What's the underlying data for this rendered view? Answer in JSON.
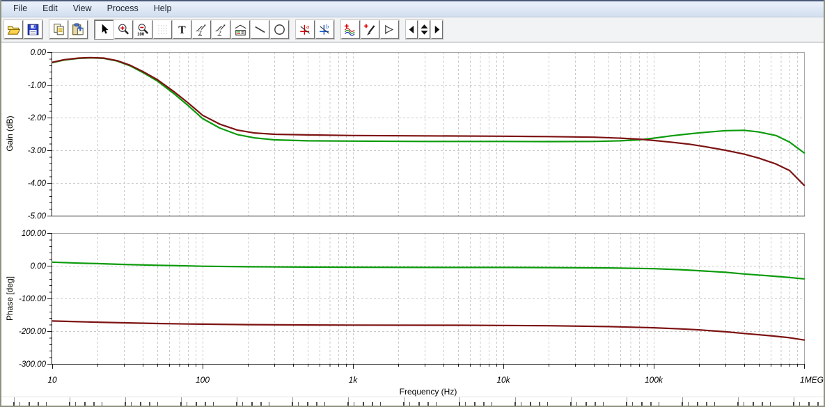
{
  "menu_bar": {
    "items": [
      {
        "label": "File"
      },
      {
        "label": "Edit"
      },
      {
        "label": "View"
      },
      {
        "label": "Process"
      },
      {
        "label": "Help"
      }
    ]
  },
  "toolbar": {
    "buttons": [
      {
        "icon": "open-folder-icon",
        "name": "open-button"
      },
      {
        "icon": "save-icon",
        "name": "save-button"
      },
      {
        "sep": true
      },
      {
        "icon": "copy-icon",
        "name": "copy-button"
      },
      {
        "icon": "paste-icon",
        "name": "paste-button"
      },
      {
        "sep": true
      },
      {
        "icon": "select-arrow-icon",
        "name": "select-tool-button",
        "state": "active"
      },
      {
        "icon": "zoom-in-icon",
        "name": "zoom-in-button"
      },
      {
        "icon": "zoom-out-100-icon",
        "name": "zoom-100-button"
      },
      {
        "icon": "grid-icon",
        "name": "grid-toggle-button",
        "state": "disabled"
      },
      {
        "icon": "text-tool-icon",
        "name": "text-tool-button"
      },
      {
        "icon": "curve-label-tool-icon",
        "name": "curve-label-tool-button"
      },
      {
        "icon": "curve-query-tool-icon",
        "name": "curve-query-tool-button"
      },
      {
        "icon": "legend-tool-icon",
        "name": "legend-tool-button"
      },
      {
        "icon": "line-tool-icon",
        "name": "line-tool-button"
      },
      {
        "icon": "ellipse-tool-icon",
        "name": "ellipse-tool-button"
      },
      {
        "sep": true
      },
      {
        "icon": "cursor-a-icon",
        "name": "cursor-a-button"
      },
      {
        "icon": "cursor-b-icon",
        "name": "cursor-b-button"
      },
      {
        "sep": true
      },
      {
        "icon": "add-curves-icon",
        "name": "add-curves-button"
      },
      {
        "icon": "probe-icon",
        "name": "probe-button"
      },
      {
        "icon": "flag-icon",
        "name": "flag-button"
      },
      {
        "sep": true
      },
      {
        "icon": "prev-arrow-icon",
        "name": "prev-button",
        "narrow": true
      },
      {
        "icon": "up-down-spinner-icon",
        "name": "spinner-control",
        "narrow": true
      },
      {
        "icon": "next-arrow-icon",
        "name": "next-button",
        "narrow": true
      }
    ]
  },
  "chart_data": [
    {
      "type": "line",
      "name": "gain-plot",
      "title": "",
      "ylabel": "Gain (dB)",
      "xlabel": "",
      "x_scale": "log",
      "x_range": [
        10,
        1000000
      ],
      "x_tick_labels": [
        "10",
        "100",
        "1k",
        "10k",
        "100k",
        "1MEG"
      ],
      "x_tick_values": [
        10,
        100,
        1000,
        10000,
        100000,
        1000000
      ],
      "ylim": [
        -5,
        0
      ],
      "y_tick_labels": [
        "0.00",
        "-1.00",
        "-2.00",
        "-3.00",
        "-4.00",
        "-5.00"
      ],
      "y_tick_values": [
        0,
        -1,
        -2,
        -3,
        -4,
        -5
      ],
      "y_minor_step": 0.2,
      "grid": true,
      "legend": "none",
      "series": [
        {
          "name": "curve-green",
          "color": "#0b9b0b",
          "points": [
            [
              10,
              -0.32
            ],
            [
              12,
              -0.24
            ],
            [
              15,
              -0.19
            ],
            [
              18,
              -0.175
            ],
            [
              22,
              -0.19
            ],
            [
              27,
              -0.27
            ],
            [
              33,
              -0.42
            ],
            [
              40,
              -0.62
            ],
            [
              50,
              -0.88
            ],
            [
              65,
              -1.28
            ],
            [
              80,
              -1.63
            ],
            [
              100,
              -2.03
            ],
            [
              130,
              -2.32
            ],
            [
              170,
              -2.52
            ],
            [
              220,
              -2.62
            ],
            [
              300,
              -2.68
            ],
            [
              500,
              -2.71
            ],
            [
              1000,
              -2.72
            ],
            [
              3000,
              -2.73
            ],
            [
              10000,
              -2.73
            ],
            [
              20000,
              -2.735
            ],
            [
              40000,
              -2.73
            ],
            [
              60000,
              -2.71
            ],
            [
              80000,
              -2.68
            ],
            [
              100000,
              -2.63
            ],
            [
              130000,
              -2.56
            ],
            [
              170000,
              -2.5
            ],
            [
              220000,
              -2.45
            ],
            [
              300000,
              -2.4
            ],
            [
              400000,
              -2.39
            ],
            [
              500000,
              -2.44
            ],
            [
              650000,
              -2.55
            ],
            [
              800000,
              -2.75
            ],
            [
              1000000,
              -3.08
            ]
          ]
        },
        {
          "name": "curve-dark-red",
          "color": "#7d1212",
          "points": [
            [
              10,
              -0.31
            ],
            [
              12,
              -0.23
            ],
            [
              15,
              -0.18
            ],
            [
              18,
              -0.165
            ],
            [
              22,
              -0.18
            ],
            [
              27,
              -0.26
            ],
            [
              33,
              -0.4
            ],
            [
              40,
              -0.59
            ],
            [
              50,
              -0.84
            ],
            [
              65,
              -1.22
            ],
            [
              80,
              -1.55
            ],
            [
              100,
              -1.93
            ],
            [
              130,
              -2.2
            ],
            [
              170,
              -2.38
            ],
            [
              220,
              -2.47
            ],
            [
              300,
              -2.51
            ],
            [
              500,
              -2.53
            ],
            [
              1000,
              -2.55
            ],
            [
              3000,
              -2.56
            ],
            [
              10000,
              -2.57
            ],
            [
              20000,
              -2.58
            ],
            [
              40000,
              -2.6
            ],
            [
              60000,
              -2.63
            ],
            [
              80000,
              -2.66
            ],
            [
              100000,
              -2.7
            ],
            [
              130000,
              -2.75
            ],
            [
              170000,
              -2.81
            ],
            [
              220000,
              -2.89
            ],
            [
              300000,
              -3.0
            ],
            [
              400000,
              -3.12
            ],
            [
              500000,
              -3.24
            ],
            [
              650000,
              -3.42
            ],
            [
              800000,
              -3.62
            ],
            [
              1000000,
              -4.07
            ]
          ]
        }
      ]
    },
    {
      "type": "line",
      "name": "phase-plot",
      "title": "",
      "ylabel": "Phase [deg]",
      "xlabel": "Frequency (Hz)",
      "x_scale": "log",
      "x_range": [
        10,
        1000000
      ],
      "x_tick_labels": [
        "10",
        "100",
        "1k",
        "10k",
        "100k",
        "1MEG"
      ],
      "x_tick_values": [
        10,
        100,
        1000,
        10000,
        100000,
        1000000
      ],
      "ylim": [
        -300,
        100
      ],
      "y_tick_labels": [
        "100.00",
        "0.00",
        "-100.00",
        "-200.00",
        "-300.00"
      ],
      "y_tick_values": [
        100,
        0,
        -100,
        -200,
        -300
      ],
      "y_minor_step": 20,
      "grid": true,
      "legend": "none",
      "series": [
        {
          "name": "curve-green",
          "color": "#0b9b0b",
          "points": [
            [
              10,
              11
            ],
            [
              15,
              8
            ],
            [
              20,
              6.5
            ],
            [
              30,
              4
            ],
            [
              50,
              1.5
            ],
            [
              80,
              -0.5
            ],
            [
              100,
              -1.5
            ],
            [
              200,
              -3
            ],
            [
              500,
              -4
            ],
            [
              1000,
              -4.5
            ],
            [
              5000,
              -5
            ],
            [
              10000,
              -5
            ],
            [
              20000,
              -5.5
            ],
            [
              50000,
              -6.5
            ],
            [
              100000,
              -9
            ],
            [
              150000,
              -12
            ],
            [
              200000,
              -15
            ],
            [
              300000,
              -20
            ],
            [
              400000,
              -25
            ],
            [
              600000,
              -31
            ],
            [
              800000,
              -36
            ],
            [
              1000000,
              -40
            ]
          ]
        },
        {
          "name": "curve-dark-red",
          "color": "#7d1212",
          "points": [
            [
              10,
              -169
            ],
            [
              15,
              -171
            ],
            [
              20,
              -172.5
            ],
            [
              30,
              -174.5
            ],
            [
              50,
              -176.5
            ],
            [
              80,
              -178
            ],
            [
              100,
              -178.5
            ],
            [
              200,
              -180
            ],
            [
              500,
              -181
            ],
            [
              1000,
              -181.5
            ],
            [
              5000,
              -182
            ],
            [
              10000,
              -182.5
            ],
            [
              20000,
              -183.5
            ],
            [
              50000,
              -186
            ],
            [
              100000,
              -189.5
            ],
            [
              150000,
              -193
            ],
            [
              200000,
              -196
            ],
            [
              300000,
              -202
            ],
            [
              400000,
              -207
            ],
            [
              600000,
              -214
            ],
            [
              800000,
              -220
            ],
            [
              1000000,
              -227
            ]
          ]
        }
      ]
    }
  ]
}
